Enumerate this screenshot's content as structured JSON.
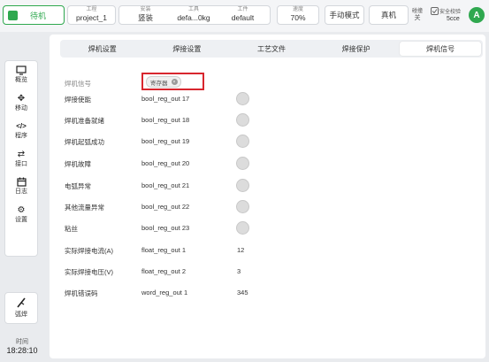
{
  "header": {
    "status_label": "待机",
    "project_label": "工程",
    "project_value": "project_1",
    "install_label": "安装",
    "install_value": "竖装",
    "tool_label": "工具",
    "tool_value": "defa...0kg",
    "workpiece_label": "工件",
    "workpiece_value": "default",
    "speed_label": "速度",
    "speed_value": "70%",
    "mode_label": "手动模式",
    "robot_label": "真机",
    "collision_line1": "碰撞",
    "collision_line2": "关",
    "safety_label": "安全校验",
    "safety_value": "5cce",
    "avatar_letter": "A",
    "accent_color": "#2fa84f"
  },
  "sidebar": {
    "items": [
      {
        "label": "概览",
        "icon": "monitor-icon"
      },
      {
        "label": "移动",
        "icon": "move-icon"
      },
      {
        "label": "程序",
        "icon": "code-icon"
      },
      {
        "label": "接口",
        "icon": "io-icon"
      },
      {
        "label": "日志",
        "icon": "calendar-icon"
      },
      {
        "label": "设置",
        "icon": "gear-icon"
      }
    ],
    "weld_label": "弧焊",
    "clock_label": "时间",
    "clock_time": "18:28:10"
  },
  "tabs": [
    "焊机设置",
    "焊接设置",
    "工艺文件",
    "焊接保护",
    "焊机信号"
  ],
  "active_tab": "焊机信号",
  "signals": {
    "header_label": "焊机信号",
    "filter_chip": "寄存器",
    "rows": [
      {
        "label": "焊接使能",
        "register": "bool_reg_out 17"
      },
      {
        "label": "焊机准备就绪",
        "register": "bool_reg_out 18"
      },
      {
        "label": "焊机起弧成功",
        "register": "bool_reg_out 19"
      },
      {
        "label": "焊机故障",
        "register": "bool_reg_out 20"
      },
      {
        "label": "电弧异常",
        "register": "bool_reg_out 21"
      },
      {
        "label": "其他流量异常",
        "register": "bool_reg_out 22"
      },
      {
        "label": "粘丝",
        "register": "bool_reg_out 23"
      },
      {
        "label": "实际焊接电流(A)",
        "register": "float_reg_out 1",
        "value": "12"
      },
      {
        "label": "实际焊接电压(V)",
        "register": "float_reg_out 2",
        "value": "3"
      },
      {
        "label": "焊机错误码",
        "register": "word_reg_out 1",
        "value": "345"
      }
    ]
  }
}
